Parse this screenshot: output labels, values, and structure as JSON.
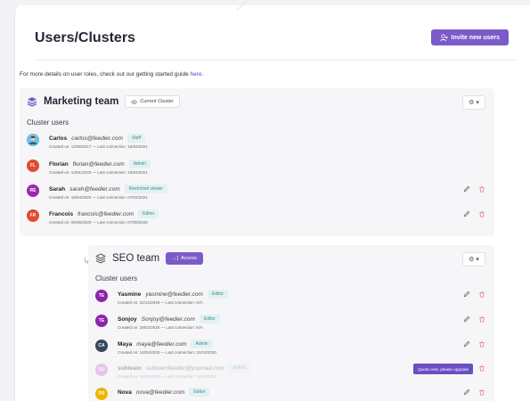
{
  "page": {
    "title": "Users/Clusters",
    "invite_label": "Invite new users",
    "intro_text": "For more details on user roles, check out our getting started guide ",
    "intro_link": "here",
    "intro_end": "."
  },
  "colors": {
    "accent": "#7b5bc9",
    "role_bg": "#e2f1f2",
    "role_fg": "#3a8c93",
    "delete": "#e57373"
  },
  "marketing": {
    "name": "Marketing team",
    "badge": "Current Cluster",
    "users_label": "Cluster users",
    "users": [
      {
        "initials": "",
        "avatar_color": "#4aa3d8",
        "name": "Carlos",
        "email": "carlos@feedier.com",
        "role": "Staff",
        "meta": "Created on: 12/05/2017 — Last connection: 16/04/2021",
        "actions": false
      },
      {
        "initials": "FL",
        "avatar_color": "#e24a2c",
        "name": "Florian",
        "email": "florian@feedier.com",
        "role": "Admin",
        "meta": "Created on: 13/01/2020 — Last connection: 19/04/2021",
        "actions": false
      },
      {
        "initials": "RE",
        "avatar_color": "#9c27b0",
        "name": "Sarah",
        "email": "sarah@feedier.com",
        "role": "Restricted viewer",
        "meta": "Created on: 16/04/2020 — Last connection: 07/04/2021",
        "actions": true
      },
      {
        "initials": "FR",
        "avatar_color": "#e24a2c",
        "name": "Francois",
        "email": "francois@feedier.com",
        "role": "Editor",
        "meta": "Created on: 05/05/2020 — Last connection: 07/08/2020",
        "actions": true
      }
    ]
  },
  "seo": {
    "name": "SEO team",
    "access_label": "Access",
    "users_label": "Cluster users",
    "quota_label": "Quota over, please upgrade",
    "users": [
      {
        "initials": "TE",
        "avatar_color": "#8e24aa",
        "name": "Yasmine",
        "email": "yasmine@feedier.com",
        "role": "Editor",
        "meta": "Created on: 31/12/2019 — Last connection: N/A"
      },
      {
        "initials": "TE",
        "avatar_color": "#8e24aa",
        "name": "Sonjoy",
        "email": "Sonjoy@feedier.com",
        "role": "Editor",
        "meta": "Created on: 28/02/2020 — Last connection: N/A"
      },
      {
        "initials": "CA",
        "avatar_color": "#37475a",
        "name": "Maya",
        "email": "maya@feedier.com",
        "role": "Admin",
        "meta": "Created on: 14/04/2020 — Last connection: 10/12/2020"
      },
      {
        "initials": "SU",
        "avatar_color": "#c46bd6",
        "name": "subteam",
        "email": "subteamfeedier@yopmail.com",
        "role": "Admin",
        "meta": "Created on: 14/04/2020 — Last connection: 14/04/2020"
      },
      {
        "initials": "PR",
        "avatar_color": "#f0b400",
        "name": "Nova",
        "email": "nova@feedier.com",
        "role": "Editor",
        "meta": ""
      }
    ]
  }
}
